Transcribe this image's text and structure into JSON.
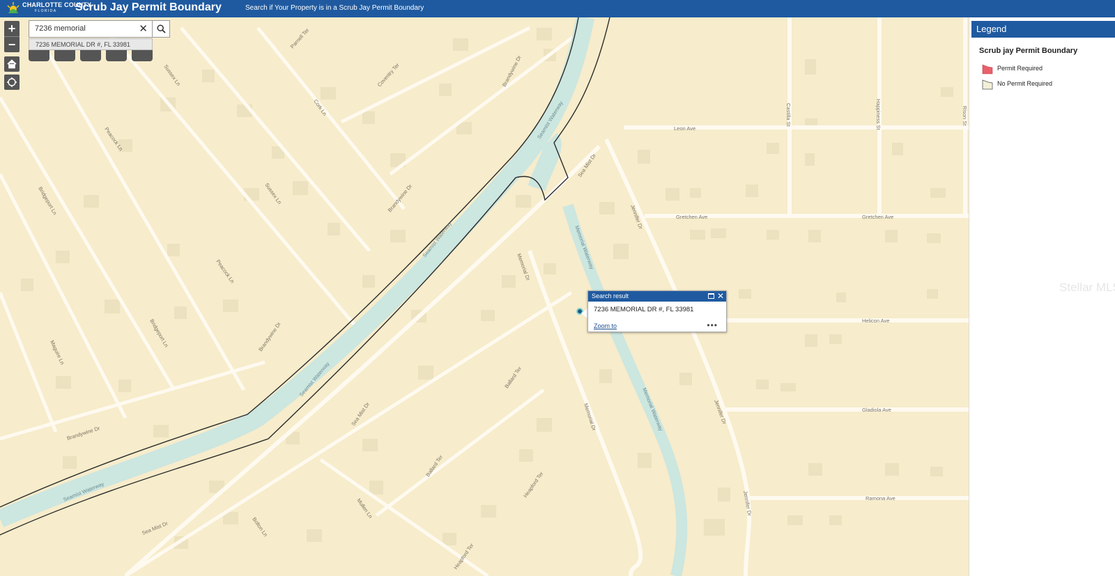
{
  "header": {
    "logo_line1": "CHARLOTTE COUNTY",
    "logo_line2": "FLORIDA",
    "title": "Scrub Jay Permit Boundary",
    "subtitle": "Search if Your Property is in a Scrub Jay Permit Boundary",
    "brand_color": "#1f5aa0"
  },
  "search": {
    "value": "7236 memorial",
    "suggestion": "7236 MEMORIAL DR #, FL 33981"
  },
  "popup": {
    "title": "Search result",
    "address": "7236 MEMORIAL DR #, FL 33981",
    "zoom_label": "Zoom to",
    "more_label": "•••"
  },
  "legend": {
    "header": "Legend",
    "layer_title": "Scrub jay Permit Boundary",
    "items": [
      {
        "label": "Permit Required",
        "color": "#e8606a"
      },
      {
        "label": "No Permit Required",
        "color": "#f3f0d8"
      }
    ]
  },
  "map": {
    "roads": {
      "parnell": "Parnell Ter",
      "sussex1": "Sussex Ln",
      "sussex2": "Sussex Ln",
      "cork": "Cork Ln",
      "coventry": "Coventry Ter",
      "brandywine1": "Brandywine Dr",
      "brandywine2": "Brandywine Dr",
      "brandywine3": "Brandywine Dr",
      "brandywine4": "Brandywine Dr",
      "peacock1": "Peacock Ln",
      "peacock2": "Peacock Ln",
      "bridgeport1": "Bridgeport Ln",
      "bridgeport2": "Bridgeport Ln",
      "maguire": "Maguire Ln",
      "seamist1": "Sea Mist Dr",
      "seamist2": "Sea Mist Dr",
      "seamist3": "Sea Mist Dr",
      "memorial1": "Memorial Dr",
      "memorial2": "Memorial Dr",
      "ballard1": "Ballard Ter",
      "ballard2": "Ballard Ter",
      "heapford1": "Heapford Ter",
      "heapford2": "Heapford Ter",
      "mullen": "Mullen Ln",
      "bolton": "Bolton Ln",
      "leon": "Leon Ave",
      "gretchen1": "Gretchen Ave",
      "gretchen2": "Gretchen Ave",
      "helicon": "Helicon Ave",
      "gladiola": "Gladiola Ave",
      "ramona": "Ramona Ave",
      "jennifer1": "Jennifer Dr",
      "jennifer2": "Jennifer Dr",
      "jennifer3": "Jennifer Dr",
      "castilla": "Castilla St",
      "happiness": "Happiness St",
      "rison": "Rison St"
    },
    "waterways": {
      "seamist_w1": "Seamist Waterway",
      "seamist_w2": "Seamist Waterway",
      "seamist_w3": "Seamist Waterway",
      "seamist_w4": "Seamist Waterway",
      "memorial_w1": "Memorial Waterway",
      "memorial_w2": "Memorial Waterway"
    }
  },
  "watermark": "Stellar MLS"
}
